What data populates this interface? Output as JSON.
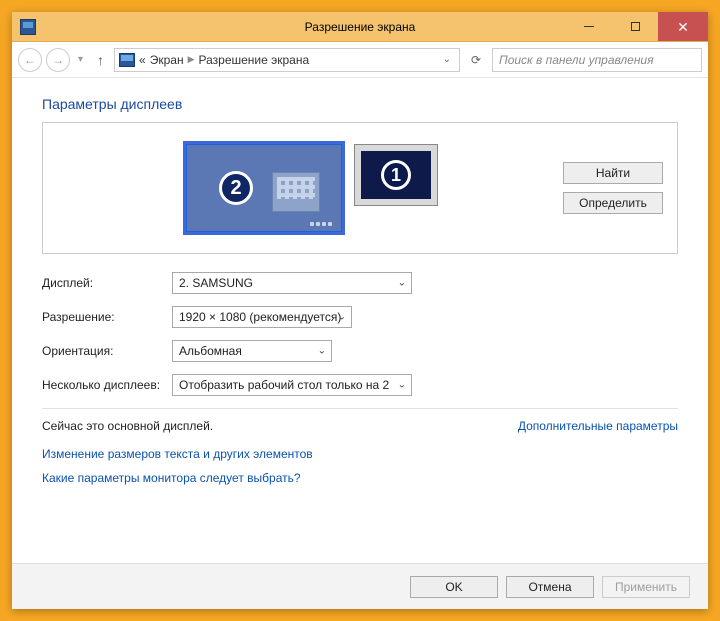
{
  "title": "Разрешение экрана",
  "breadcrumb": {
    "prefix": "«",
    "l1": "Экран",
    "l2": "Разрешение экрана"
  },
  "search_placeholder": "Поиск в панели управления",
  "heading": "Параметры дисплеев",
  "side": {
    "find": "Найти",
    "identify": "Определить"
  },
  "monitors": {
    "primary_num": "2",
    "secondary_num": "1"
  },
  "form": {
    "display_label": "Дисплей:",
    "display_value": "2. SAMSUNG",
    "resolution_label": "Разрешение:",
    "resolution_value": "1920 × 1080 (рекомендуется)",
    "orientation_label": "Ориентация:",
    "orientation_value": "Альбомная",
    "multi_label": "Несколько дисплеев:",
    "multi_value": "Отобразить рабочий стол только на 2"
  },
  "status_text": "Сейчас это основной дисплей.",
  "adv_link": "Дополнительные параметры",
  "link1": "Изменение размеров текста и других элементов",
  "link2": "Какие параметры монитора следует выбрать?",
  "footer": {
    "ok": "OK",
    "cancel": "Отмена",
    "apply": "Применить"
  }
}
